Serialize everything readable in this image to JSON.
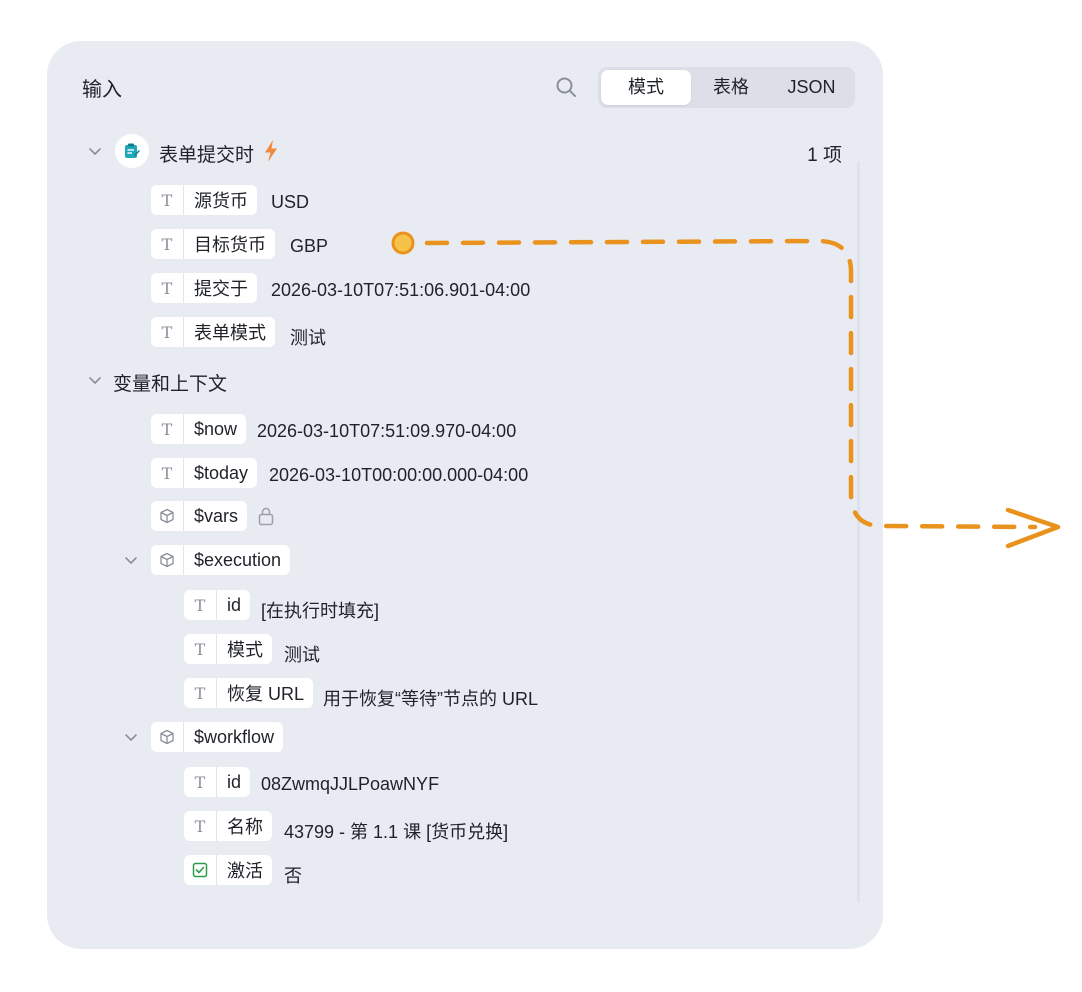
{
  "panel": {
    "title": "输入",
    "tabs": [
      {
        "label": "模式",
        "active": true
      },
      {
        "label": "表格",
        "active": false
      },
      {
        "label": "JSON",
        "active": false
      }
    ]
  },
  "trigger": {
    "name": "表单提交时",
    "count": "1 项",
    "fields": [
      {
        "type": "T",
        "key": "源货币",
        "value": "USD"
      },
      {
        "type": "T",
        "key": "目标货币",
        "value": "GBP"
      },
      {
        "type": "T",
        "key": "提交于",
        "value": "2026-03-10T07:51:06.901-04:00"
      },
      {
        "type": "T",
        "key": "表单模式",
        "value": "测试"
      }
    ]
  },
  "context": {
    "label": "变量和上下文",
    "now": {
      "type": "T",
      "key": "$now",
      "value": "2026-03-10T07:51:09.970-04:00"
    },
    "today": {
      "type": "T",
      "key": "$today",
      "value": "2026-03-10T00:00:00.000-04:00"
    },
    "vars": {
      "type": "object",
      "key": "$vars"
    },
    "execution": {
      "key": "$execution",
      "fields": [
        {
          "type": "T",
          "key": "id",
          "value": "[在执行时填充]"
        },
        {
          "type": "T",
          "key": "模式",
          "value": "测试"
        },
        {
          "type": "T",
          "key": "恢复 URL",
          "value": "用于恢复“等待”节点的 URL"
        }
      ]
    },
    "workflow": {
      "key": "$workflow",
      "fields": [
        {
          "type": "T",
          "key": "id",
          "value": "08ZwmqJJLPoawNYF"
        },
        {
          "type": "T",
          "key": "名称",
          "value": "43799 - 第 1.1 课 [货币兑换]"
        },
        {
          "type": "boolean",
          "key": "激活",
          "value": "否"
        }
      ]
    }
  },
  "colors": {
    "panel_bg": "#e9ebf3",
    "accent_orange": "#e9921d",
    "boolean_green": "#2a9d4a",
    "trigger_teal": "#1fa8b8"
  }
}
